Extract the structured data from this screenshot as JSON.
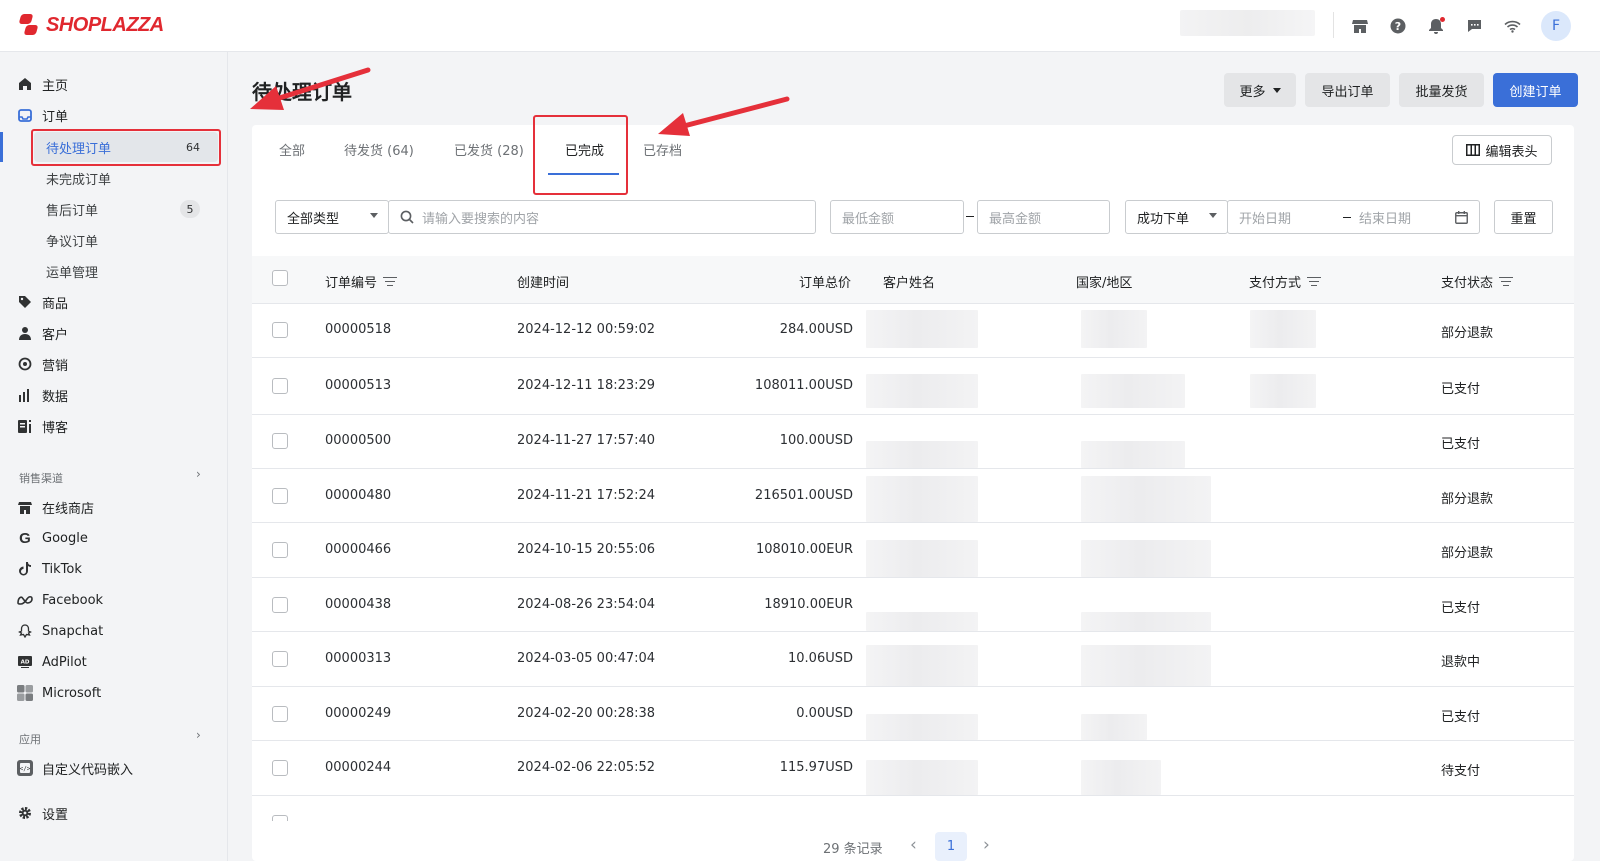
{
  "brand": {
    "name": "SHOPLAZZA",
    "accent": "#e0282f",
    "primary": "#3a6fd8"
  },
  "topbar": {
    "avatar_letter": "F",
    "icons": [
      "store-icon",
      "help-icon",
      "bell-icon",
      "chat-icon",
      "wifi-icon"
    ]
  },
  "sidebar": {
    "home": "主页",
    "orders": "订单",
    "sub": [
      {
        "label": "待处理订单",
        "badge": "64"
      },
      {
        "label": "未完成订单",
        "badge": ""
      },
      {
        "label": "售后订单",
        "badge": "5"
      },
      {
        "label": "争议订单",
        "badge": ""
      },
      {
        "label": "运单管理",
        "badge": ""
      }
    ],
    "products": "商品",
    "customers": "客户",
    "marketing": "营销",
    "analytics": "数据",
    "blog": "博客",
    "channels_head": "销售渠道",
    "channels": [
      "在线商店",
      "Google",
      "TikTok",
      "Facebook",
      "Snapchat",
      "AdPilot",
      "Microsoft"
    ],
    "apps_head": "应用",
    "apps": [
      "自定义代码嵌入"
    ],
    "settings": "设置"
  },
  "page": {
    "title": "待处理订单",
    "buttons": {
      "more": "更多",
      "export": "导出订单",
      "bulk_ship": "批量发货",
      "create": "创建订单"
    },
    "tabs": [
      "全部",
      "待发货 (64)",
      "已发货 (28)",
      "已完成",
      "已存档"
    ],
    "edit_columns": "编辑表头"
  },
  "filters": {
    "type": "全部类型",
    "search_placeholder": "请输入要搜索的内容",
    "min_amount": "最低金额",
    "max_amount": "最高金额",
    "order_status": "成功下单",
    "start_date": "开始日期",
    "end_date": "结束日期",
    "reset": "重置"
  },
  "table": {
    "headers": {
      "order_no": "订单编号",
      "created": "创建时间",
      "total": "订单总价",
      "customer": "客户姓名",
      "country": "国家/地区",
      "pay_method": "支付方式",
      "pay_status": "支付状态"
    },
    "rows": [
      {
        "order_no": "00000518",
        "created": "2024-12-12 00:59:02",
        "total": "284.00USD",
        "status": "部分退款"
      },
      {
        "order_no": "00000513",
        "created": "2024-12-11 18:23:29",
        "total": "108011.00USD",
        "status": "已支付"
      },
      {
        "order_no": "00000500",
        "created": "2024-11-27 17:57:40",
        "total": "100.00USD",
        "status": "已支付"
      },
      {
        "order_no": "00000480",
        "created": "2024-11-21 17:52:24",
        "total": "216501.00USD",
        "status": "部分退款"
      },
      {
        "order_no": "00000466",
        "created": "2024-10-15 20:55:06",
        "total": "108010.00EUR",
        "status": "部分退款"
      },
      {
        "order_no": "00000438",
        "created": "2024-08-26 23:54:04",
        "total": "18910.00EUR",
        "status": "已支付"
      },
      {
        "order_no": "00000313",
        "created": "2024-03-05 00:47:04",
        "total": "10.06USD",
        "status": "退款中"
      },
      {
        "order_no": "00000249",
        "created": "2024-02-20 00:28:38",
        "total": "0.00USD",
        "status": "已支付"
      },
      {
        "order_no": "00000244",
        "created": "2024-02-06 22:05:52",
        "total": "115.97USD",
        "status": "待支付"
      }
    ]
  },
  "pagination": {
    "total": "29 条记录",
    "current": "1"
  }
}
